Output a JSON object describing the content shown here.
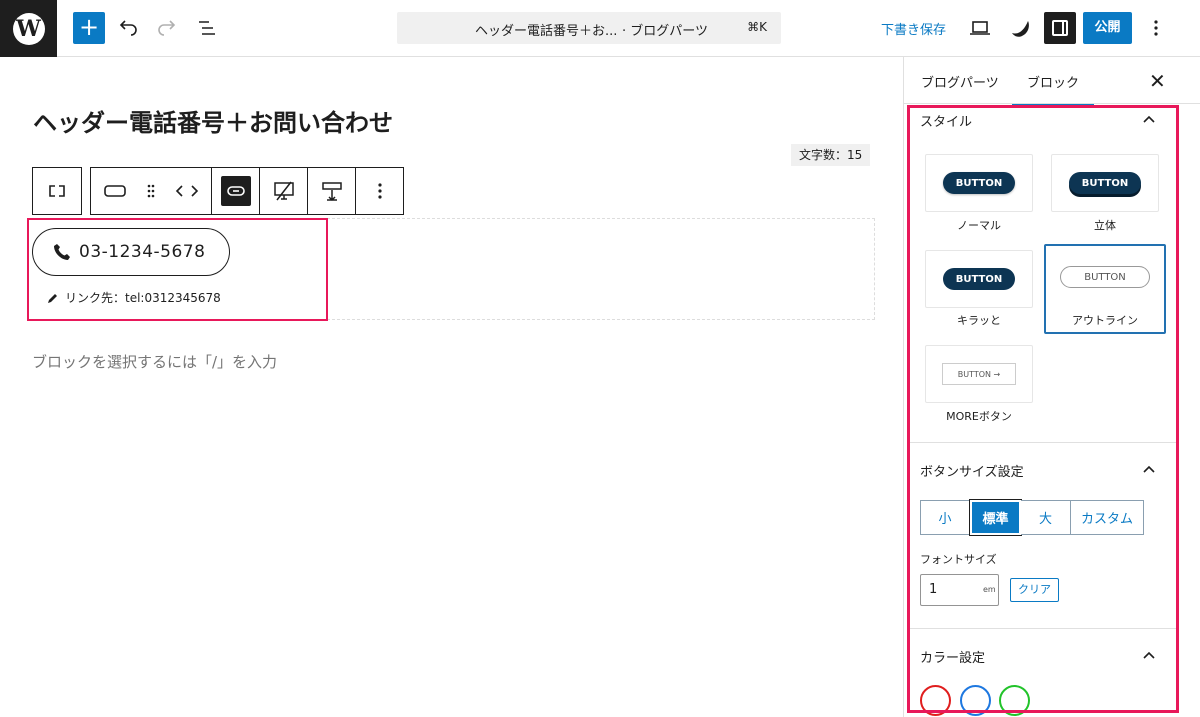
{
  "topbar": {
    "doc_title": "ヘッダー電話番号＋お...",
    "doc_type": "· ブログパーツ",
    "shortcut": "⌘K",
    "draft_label": "下書き保存",
    "publish_label": "公開",
    "wp_logo_letter": "W",
    "add_label": "+"
  },
  "editor": {
    "post_title": "ヘッダー電話番号＋お問い合わせ",
    "char_count": "文字数：15",
    "phone_number": "03-1234-5678",
    "link_label": "リンク先：tel:0312345678",
    "placeholder": "ブロックを選択するには「/」を入力"
  },
  "sidebar": {
    "tabs": [
      {
        "label": "ブログパーツ"
      },
      {
        "label": "ブロック"
      }
    ],
    "active_tab": "ブロック",
    "close_icon": "close-icon",
    "style_panel": {
      "title": "スタイル",
      "options": [
        {
          "label": "ノーマル",
          "preview": "BUTTON"
        },
        {
          "label": "立体",
          "preview": "BUTTON"
        },
        {
          "label": "キラッと",
          "preview": "BUTTON"
        },
        {
          "label": "アウトライン",
          "preview": "BUTTON"
        },
        {
          "label": "MOREボタン",
          "preview": "BUTTON  →"
        }
      ],
      "selected": "アウトライン"
    },
    "size_panel": {
      "title": "ボタンサイズ設定",
      "sizes": [
        {
          "label": "小"
        },
        {
          "label": "標準"
        },
        {
          "label": "大"
        },
        {
          "label": "カスタム"
        }
      ],
      "selected": "標準",
      "font_size_label": "フォントサイズ",
      "font_size_value": "1",
      "font_size_unit": "em",
      "clear_label": "クリア"
    },
    "color_panel": {
      "title": "カラー設定",
      "swatches": [
        "#e01e1e",
        "#1e78e0",
        "#22c32a"
      ]
    }
  },
  "colors": {
    "accent": "#0a7ac4",
    "highlight": "#e8185a",
    "dark": "#1e1e1e",
    "button_navy": "#0d3553"
  }
}
